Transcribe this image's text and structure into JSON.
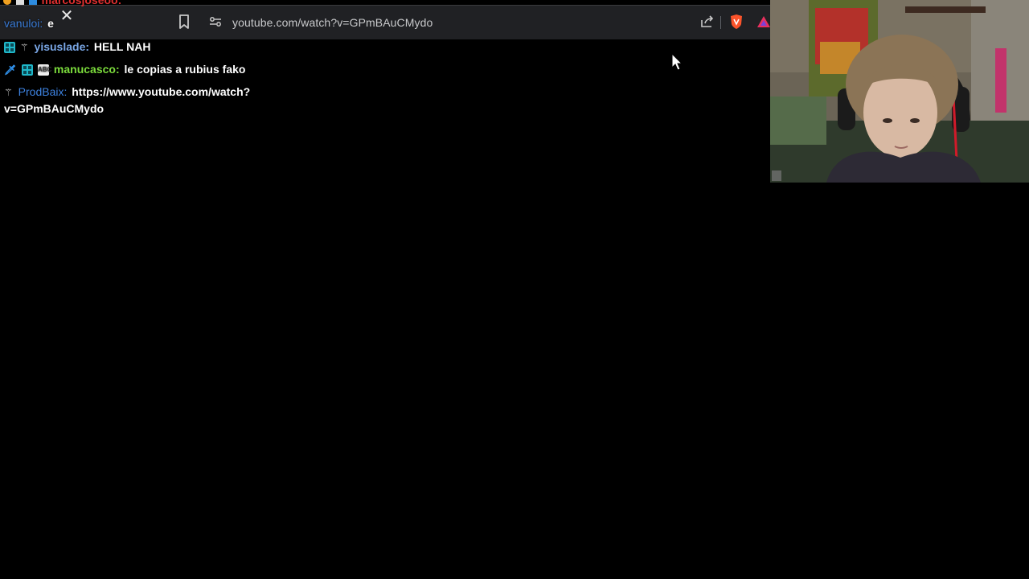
{
  "browser": {
    "url": "youtube.com/watch?v=GPmBAuCMydo",
    "icons": {
      "close": "close-icon",
      "bookmark": "bookmark-icon",
      "site_settings": "site-settings-icon",
      "share": "share-icon",
      "brave": "brave-shield-icon",
      "rewards": "brave-rewards-icon"
    },
    "toolbar_color": "#202124"
  },
  "chat": {
    "clipped_line": {
      "username": "marcosjoseoo:"
    },
    "messages": [
      {
        "username": "vanuloi:",
        "text": "e",
        "color": "#3a7bd5"
      },
      {
        "badges": [
          "subscriber-badge",
          "vip-sword-badge"
        ],
        "username": "yisuslade:",
        "text": "HELL NAH",
        "color": "#7aa7e6"
      },
      {
        "badges": [
          "sword-badge",
          "subscriber-badge",
          "abc-badge"
        ],
        "username": "manucasco:",
        "text": "le copias a rubius fako",
        "color": "#7cdc3c"
      },
      {
        "badges": [
          "vip-sword-badge"
        ],
        "username": "ProdBaix:",
        "text": "https://www.youtube.com/watch?",
        "text_continued": "v=GPmBAuCMydo",
        "color": "#3d82e0"
      }
    ]
  },
  "webcam": {
    "label": "webcam-feed"
  },
  "colors": {
    "background": "#000000",
    "chat_text": "#ffffff"
  }
}
